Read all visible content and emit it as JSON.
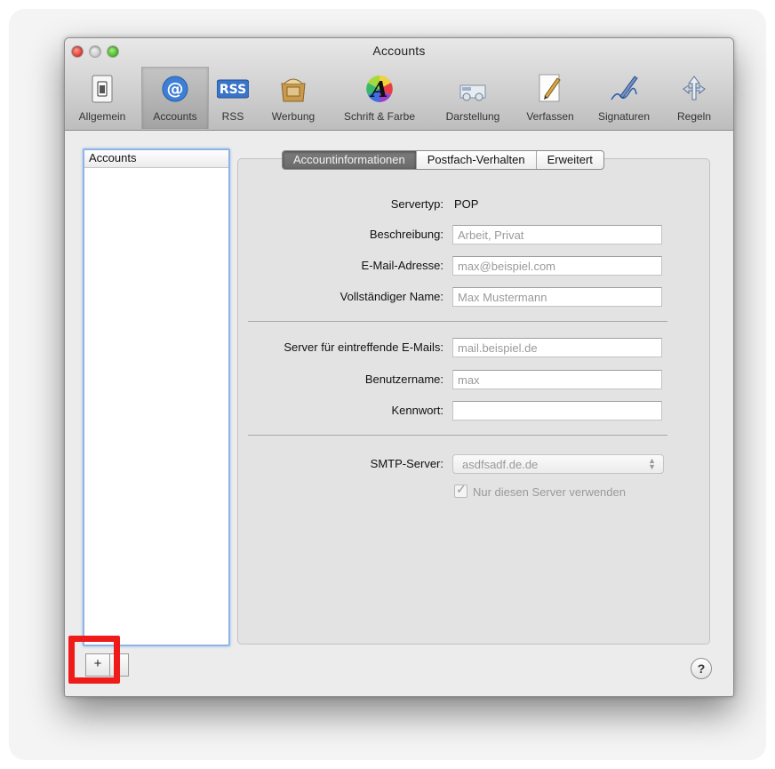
{
  "window": {
    "title": "Accounts"
  },
  "toolbar": {
    "items": [
      {
        "label": "Allgemein",
        "icon": "general-switch-icon"
      },
      {
        "label": "Accounts",
        "icon": "at-sign-icon"
      },
      {
        "label": "RSS",
        "icon": "rss-icon"
      },
      {
        "label": "Werbung",
        "icon": "junk-mail-icon"
      },
      {
        "label": "Schrift & Farbe",
        "icon": "font-color-icon"
      },
      {
        "label": "Darstellung",
        "icon": "viewing-icon"
      },
      {
        "label": "Verfassen",
        "icon": "composing-icon"
      },
      {
        "label": "Signaturen",
        "icon": "signature-icon"
      },
      {
        "label": "Regeln",
        "icon": "rules-icon"
      }
    ],
    "selected": "Accounts"
  },
  "sidebar": {
    "header": "Accounts",
    "add_button": "+",
    "remove_button": ""
  },
  "tabs": [
    {
      "label": "Accountinformationen",
      "active": true
    },
    {
      "label": "Postfach-Verhalten",
      "active": false
    },
    {
      "label": "Erweitert",
      "active": false
    }
  ],
  "form": {
    "server_type_label": "Servertyp:",
    "server_type_value": "POP",
    "description_label": "Beschreibung:",
    "description_placeholder": "Arbeit, Privat",
    "email_label": "E-Mail-Adresse:",
    "email_placeholder": "max@beispiel.com",
    "fullname_label": "Vollständiger Name:",
    "fullname_placeholder": "Max Mustermann",
    "incoming_label": "Server für eintreffende E-Mails:",
    "incoming_placeholder": "mail.beispiel.de",
    "username_label": "Benutzername:",
    "username_placeholder": "max",
    "password_label": "Kennwort:",
    "password_value": "",
    "smtp_label": "SMTP-Server:",
    "smtp_value": "asdfsadf.de.de",
    "only_server_label": "Nur diesen Server verwenden",
    "only_server_checked": true
  },
  "help": {
    "label": "?"
  },
  "colors": {
    "highlight": "#ef1b1b",
    "list_focus": "#8fb4e4",
    "active_tab": "#737373"
  }
}
